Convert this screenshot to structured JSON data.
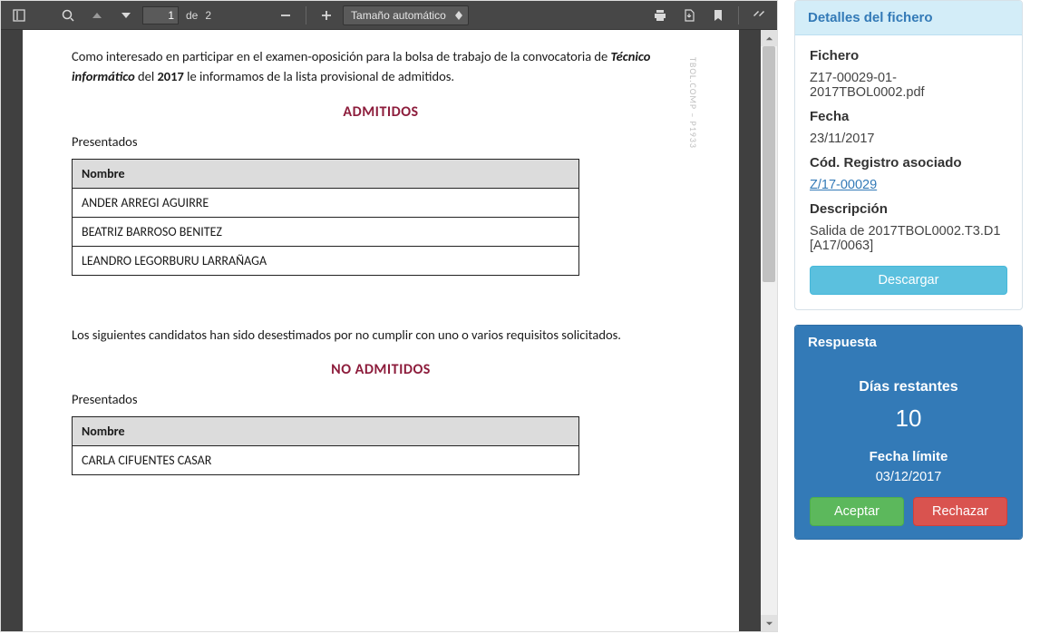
{
  "pdf": {
    "toolbar": {
      "page_current": "1",
      "page_sep": "de",
      "page_total": "2",
      "zoom_label": "Tamaño automático"
    },
    "doc": {
      "watermark": "TBOL.COMP – P1933",
      "intro_1": "Como interesado en participar en el examen-oposición para la bolsa de trabajo de la convocatoria de ",
      "intro_em": "Técnico informático",
      "intro_2": " del ",
      "intro_year": "2017",
      "intro_3": " le informamos de la lista provisional de admitidos.",
      "h_admitidos": "ADMITIDOS",
      "presentados": "Presentados",
      "col_nombre": "Nombre",
      "admit": [
        "ANDER ARREGI AGUIRRE",
        "BEATRIZ BARROSO BENITEZ",
        "LEANDRO LEGORBURU LARRAÑAGA"
      ],
      "mid_text": "Los siguientes candidatos han sido desestimados por no cumplir con uno o varios requisitos solicitados.",
      "h_noadmit": "NO ADMITIDOS",
      "noadmit": [
        "CARLA CIFUENTES CASAR"
      ]
    }
  },
  "details": {
    "title": "Detalles del fichero",
    "fichero_lbl": "Fichero",
    "fichero_val": "Z17-00029-01-2017TBOL0002.pdf",
    "fecha_lbl": "Fecha",
    "fecha_val": "23/11/2017",
    "cod_lbl": "Cód. Registro asociado",
    "cod_val": "Z/17-00029",
    "desc_lbl": "Descripción",
    "desc_val": "Salida de 2017TBOL0002.T3.D1 [A17/0063]",
    "download": "Descargar"
  },
  "response": {
    "title": "Respuesta",
    "days_lbl": "Días restantes",
    "days_val": "10",
    "limit_lbl": "Fecha límite",
    "limit_val": "03/12/2017",
    "accept": "Aceptar",
    "reject": "Rechazar"
  }
}
